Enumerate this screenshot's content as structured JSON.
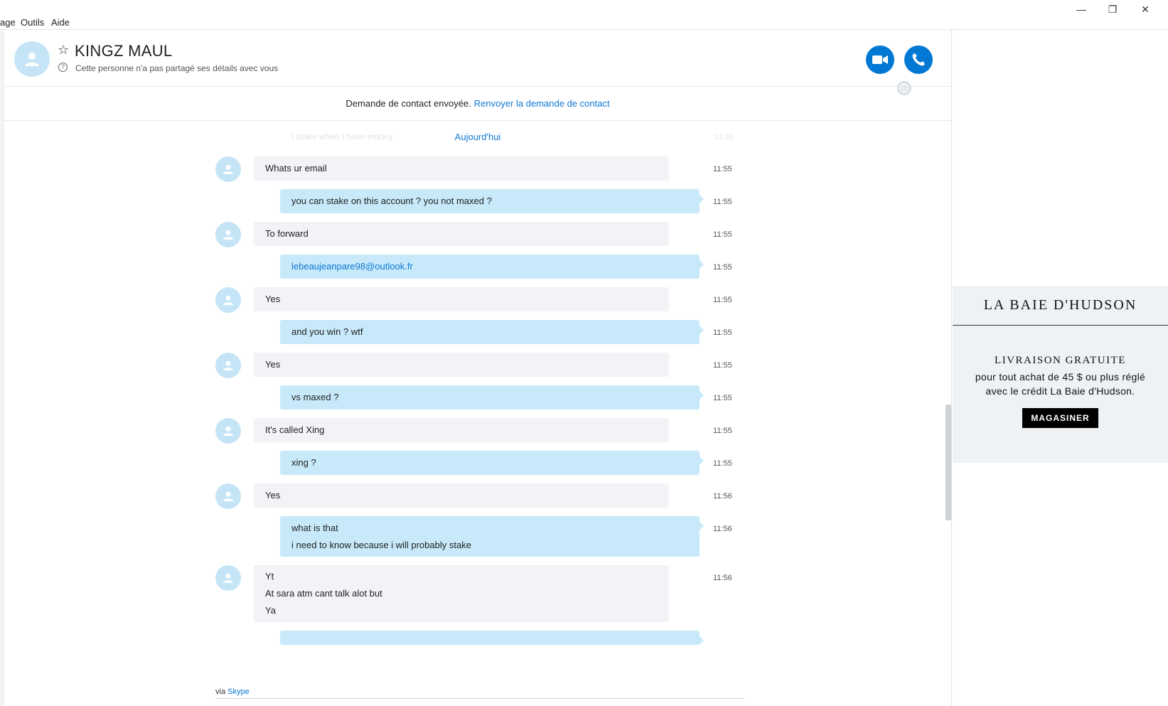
{
  "menu": {
    "items": [
      "age",
      "Outils",
      "Aide"
    ]
  },
  "window_controls": {
    "minimize": "—",
    "restore": "❐",
    "close": "✕"
  },
  "header": {
    "contact_name": "KINGZ MAUL",
    "subtitle": "Cette personne n'a pas partagé ses détails avec vous",
    "star_icon": "☆",
    "info_icon": "?"
  },
  "contact_request": {
    "text": "Demande de contact envoyée.",
    "link": "Renvoyer la demande de contact"
  },
  "conversation": {
    "ghost_message": "I stake when I have money",
    "ghost_time": "11:55",
    "date_divider": "Aujourd'hui",
    "messages": [
      {
        "dir": "in",
        "lines": [
          "Whats ur email"
        ],
        "time": "11:55"
      },
      {
        "dir": "out",
        "lines": [
          "you can stake on this account ? you not maxed ?"
        ],
        "time": "11:55"
      },
      {
        "dir": "in",
        "lines": [
          "To forward"
        ],
        "time": "11:55"
      },
      {
        "dir": "out",
        "lines": [
          "lebeaujeanpare98@outlook.fr"
        ],
        "time": "11:55",
        "link": true
      },
      {
        "dir": "in",
        "lines": [
          "Yes"
        ],
        "time": "11:55"
      },
      {
        "dir": "out",
        "lines": [
          "and you win ? wtf"
        ],
        "time": "11:55"
      },
      {
        "dir": "in",
        "lines": [
          "Yes"
        ],
        "time": "11:55"
      },
      {
        "dir": "out",
        "lines": [
          "vs maxed ?"
        ],
        "time": "11:55"
      },
      {
        "dir": "in",
        "lines": [
          "It's called Xing"
        ],
        "time": "11:55"
      },
      {
        "dir": "out",
        "lines": [
          "xing ?"
        ],
        "time": "11:55"
      },
      {
        "dir": "in",
        "lines": [
          "Yes"
        ],
        "time": "11:56"
      },
      {
        "dir": "out",
        "lines": [
          "what is that",
          "i need to know because i will probably stake"
        ],
        "time": "11:56"
      },
      {
        "dir": "in",
        "lines": [
          "Yt",
          "At sara atm cant talk alot but",
          "Ya"
        ],
        "time": "11:56"
      }
    ]
  },
  "footer": {
    "via": "via",
    "via_link": "Skype"
  },
  "ad": {
    "brand": "LA BAIE D'HUDSON",
    "headline": "LIVRAISON GRATUITE",
    "body_line1": "pour tout achat de 45 $ ou plus réglé",
    "body_line2": "avec le crédit La Baie d'Hudson.",
    "cta": "MAGASINER"
  },
  "colors": {
    "accent": "#0078d4",
    "link": "#0f78d4",
    "incoming_bubble": "#f1f3f6",
    "outgoing_bubble": "#c7e9f9",
    "avatar": "#c5e5f7"
  }
}
